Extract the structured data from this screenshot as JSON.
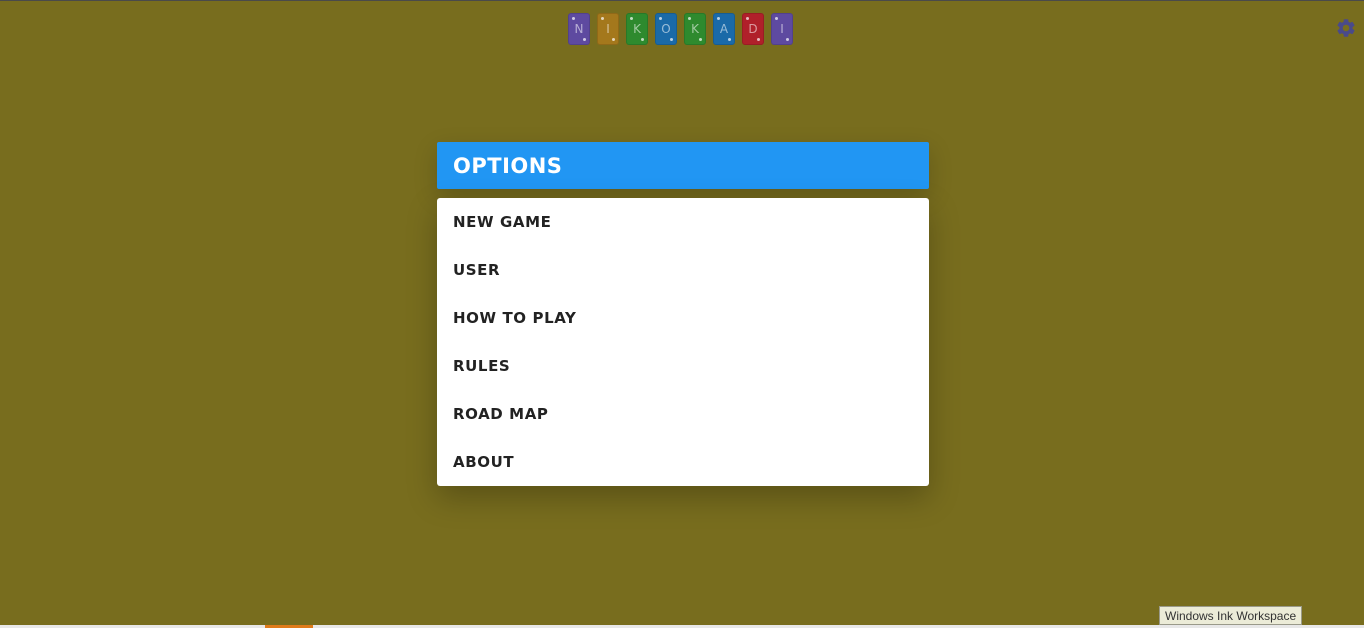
{
  "logo": {
    "letters": [
      {
        "char": "N",
        "color": "#5e4aa0"
      },
      {
        "char": "I",
        "color": "#a4781c"
      },
      {
        "char": "K",
        "color": "#2e8a2e"
      },
      {
        "char": "O",
        "color": "#1a6aa8"
      },
      {
        "char": "K",
        "color": "#2e8a2e"
      },
      {
        "char": "A",
        "color": "#1a6aa8"
      },
      {
        "char": "D",
        "color": "#b0202a"
      },
      {
        "char": "I",
        "color": "#5e4aa0"
      }
    ]
  },
  "settings": {
    "icon": "gear-icon",
    "color": "#4a4a8a"
  },
  "modal": {
    "title": "OPTIONS",
    "header_color": "#2196f3",
    "items": [
      {
        "label": "NEW GAME"
      },
      {
        "label": "USER"
      },
      {
        "label": "HOW TO PLAY"
      },
      {
        "label": "RULES"
      },
      {
        "label": "ROAD MAP"
      },
      {
        "label": "ABOUT"
      }
    ]
  },
  "tooltip": {
    "text": "Windows Ink Workspace"
  },
  "theme": {
    "background": "#786d1e",
    "accent": "#e07b1a"
  }
}
